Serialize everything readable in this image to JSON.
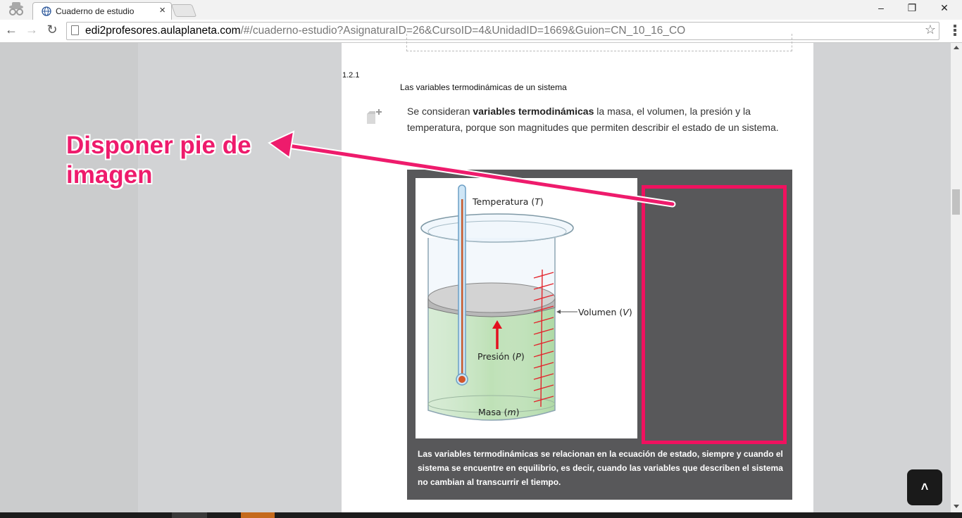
{
  "browser": {
    "tab_title": "Cuaderno de estudio",
    "tab_close": "×",
    "url_host": "edi2profesores.aulaplaneta.com",
    "url_path": "/#/cuaderno-estudio?AsignaturaID=26&CursoID=4&UnidadID=1669&Guion=CN_10_16_CO",
    "back": "←",
    "forward": "→",
    "reload": "↻",
    "bookmark_star": "☆",
    "minimize": "–",
    "restore": "❐",
    "close": "✕"
  },
  "section": {
    "number": "1.2.1",
    "title": "Las variables termodinámicas de un sistema"
  },
  "paragraph": {
    "before": "Se consideran ",
    "bold": "variables termodinámicas",
    "after": " la masa, el volumen, la presión y la temperatura, porque son magnitudes que permiten describir el estado de un sistema."
  },
  "figure": {
    "label_temperature": "Temperatura (",
    "label_temperature_var": "T",
    "label_volume": "Volumen (",
    "label_volume_var": "V",
    "label_pressure": "Presión (",
    "label_pressure_var": "P",
    "label_mass": "Masa (",
    "label_mass_var": "m",
    "close_paren": ")",
    "caption": "Las variables termodinámicas se relacionan en la ecuación de estado, siempre y cuando el sistema se encuentre en equilibrio, es decir, cuando las variables que describen el sistema no cambian al transcurrir el tiempo."
  },
  "annotation": {
    "line1": "Disponer pie de",
    "line2": "imagen"
  },
  "scroll_top_icon": "˄",
  "colors": {
    "annotation": "#ee1b6c",
    "figure_bg": "#58585a",
    "liquid": "#a6d889",
    "scale_red": "#e3262d"
  }
}
